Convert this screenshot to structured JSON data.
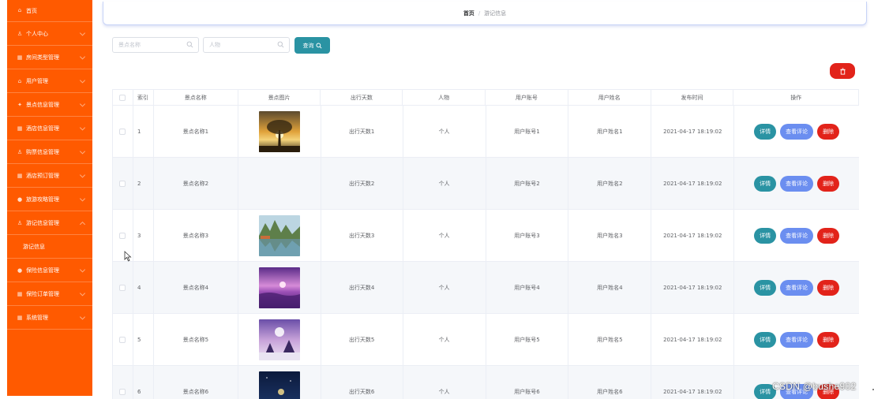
{
  "sidebar": {
    "items": [
      {
        "label": "首页",
        "icon": "home-icon"
      },
      {
        "label": "个人中心",
        "icon": "user-icon"
      },
      {
        "label": "房间类型管理",
        "icon": "grid-icon"
      },
      {
        "label": "用户管理",
        "icon": "home-icon"
      },
      {
        "label": "景点信息管理",
        "icon": "star-icon"
      },
      {
        "label": "酒店信息管理",
        "icon": "grid-icon"
      },
      {
        "label": "购票信息管理",
        "icon": "user-icon"
      },
      {
        "label": "酒店预订管理",
        "icon": "grid-icon"
      },
      {
        "label": "旅游攻略管理",
        "icon": "dot-icon"
      },
      {
        "label": "游记信息管理",
        "icon": "user-icon"
      }
    ],
    "submenu": {
      "label": "游记信息"
    },
    "items_after": [
      {
        "label": "保险信息管理",
        "icon": "dot-icon"
      },
      {
        "label": "保险订单管理",
        "icon": "grid-icon"
      },
      {
        "label": "系统管理",
        "icon": "grid-icon"
      }
    ]
  },
  "breadcrumb": {
    "home": "首页",
    "separator": "/",
    "current": "游记信息"
  },
  "search": {
    "name_placeholder": "景点名称",
    "person_placeholder": "人物",
    "query_label": "查询"
  },
  "table": {
    "headers": {
      "index": "索引",
      "name": "景点名称",
      "picture": "景点图片",
      "days": "出行天数",
      "person": "人物",
      "account": "用户账号",
      "username": "用户姓名",
      "time": "发布时间",
      "ops": "操作"
    },
    "buttons": {
      "detail": "详情",
      "comment": "查看评论",
      "delete": "删除"
    },
    "rows": [
      {
        "index": "1",
        "name": "景点名称1",
        "days": "出行天数1",
        "person": "个人",
        "account": "用户账号1",
        "username": "用户姓名1",
        "time": "2021-04-17 18:19:02",
        "image": "sunset-tree"
      },
      {
        "index": "2",
        "name": "景点名称2",
        "days": "出行天数2",
        "person": "个人",
        "account": "用户账号2",
        "username": "用户姓名2",
        "time": "2021-04-17 18:19:02",
        "image": ""
      },
      {
        "index": "3",
        "name": "景点名称3",
        "days": "出行天数3",
        "person": "个人",
        "account": "用户账号3",
        "username": "用户姓名3",
        "time": "2021-04-17 18:19:02",
        "image": "lake-mountains"
      },
      {
        "index": "4",
        "name": "景点名称4",
        "days": "出行天数4",
        "person": "个人",
        "account": "用户账号4",
        "username": "用户姓名4",
        "time": "2021-04-17 18:19:02",
        "image": "purple-sea"
      },
      {
        "index": "5",
        "name": "景点名称5",
        "days": "出行天数5",
        "person": "个人",
        "account": "用户账号5",
        "username": "用户姓名5",
        "time": "2021-04-17 18:19:02",
        "image": "snow-castle"
      },
      {
        "index": "6",
        "name": "景点名称6",
        "days": "出行天数6",
        "person": "个人",
        "account": "用户账号6",
        "username": "用户姓名6",
        "time": "2021-04-17 18:19:02",
        "image": "night-sky"
      }
    ]
  },
  "watermark": "CSDN @bushe902",
  "colors": {
    "sidebar": "#ff5a00",
    "teal": "#2a93a3",
    "blue": "#6b8ef0",
    "red": "#e2231a"
  }
}
